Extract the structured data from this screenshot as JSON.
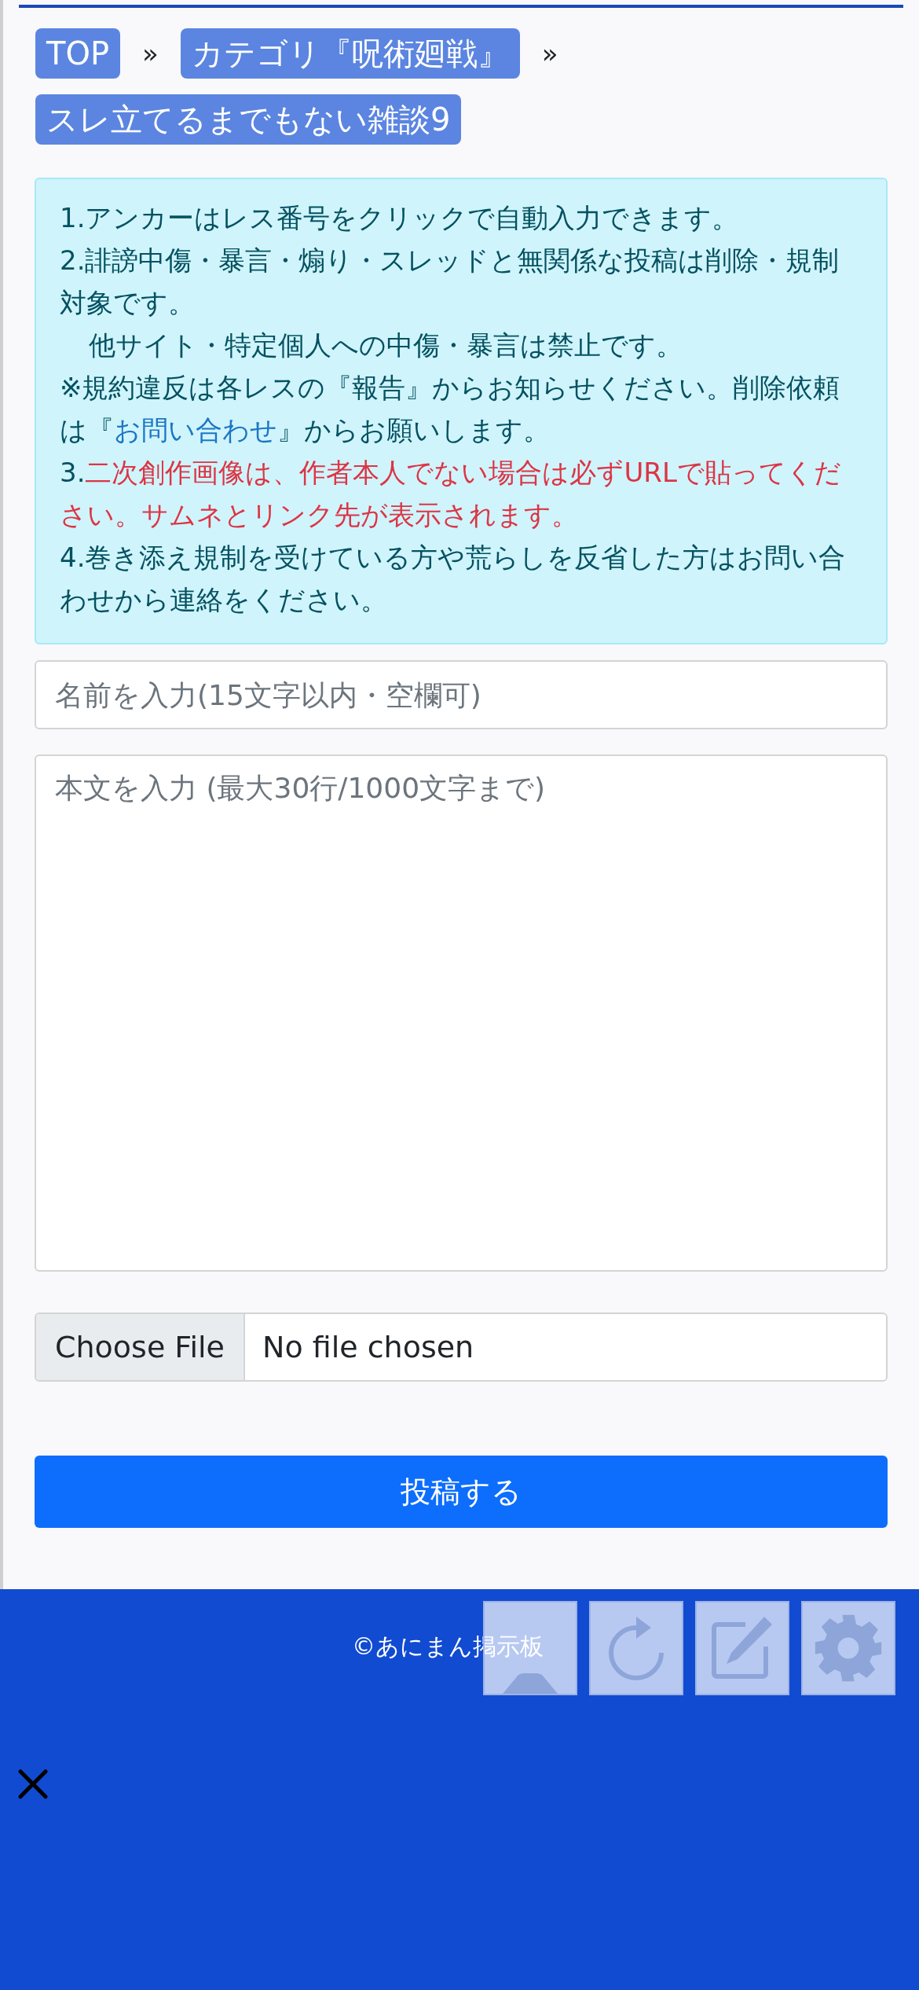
{
  "breadcrumbs": [
    {
      "label": "TOP"
    },
    {
      "label": "カテゴリ『呪術廻戦』"
    },
    {
      "label": "スレ立てるまでもない雑談9"
    }
  ],
  "breadcrumb_separator": "»",
  "notice": [
    {
      "kind": "plain",
      "parts": [
        {
          "kind": "plain",
          "text": "1.アンカーはレス番号をクリックで自動入力できます。"
        }
      ]
    },
    {
      "kind": "plain",
      "parts": [
        {
          "kind": "plain",
          "text": "2.誹謗中傷・暴言・煽り・スレッドと無関係な投稿は削除・規制対象です。"
        }
      ]
    },
    {
      "kind": "indent",
      "parts": [
        {
          "kind": "plain",
          "text": "他サイト・特定個人への中傷・暴言は禁止です。"
        }
      ]
    },
    {
      "kind": "plain",
      "parts": [
        {
          "kind": "plain",
          "text": "※規約違反は各レスの『報告』からお知らせください。削除依頼は『"
        },
        {
          "kind": "link",
          "text": "お問い合わせ"
        },
        {
          "kind": "plain",
          "text": "』からお願いします。"
        }
      ]
    },
    {
      "kind": "plain",
      "parts": [
        {
          "kind": "plain",
          "text": "3."
        },
        {
          "kind": "warning",
          "text": "二次創作画像は、作者本人でない場合は必ずURLで貼ってください。サムネとリンク先が表示されます。"
        }
      ]
    },
    {
      "kind": "plain",
      "parts": [
        {
          "kind": "plain",
          "text": "4.巻き添え規制を受けている方や荒らしを反省した方はお問い合わせから連絡をください。"
        }
      ]
    }
  ],
  "name_field": {
    "placeholder": "名前を入力(15文字以内・空欄可)"
  },
  "body_field": {
    "placeholder": "本文を入力 (最大30行/1000文字まで)"
  },
  "file_input": {
    "button": "Choose File",
    "status": "No file chosen"
  },
  "submit_button": "投稿する",
  "footer": {
    "copyright": "©あにまん掲示板"
  }
}
